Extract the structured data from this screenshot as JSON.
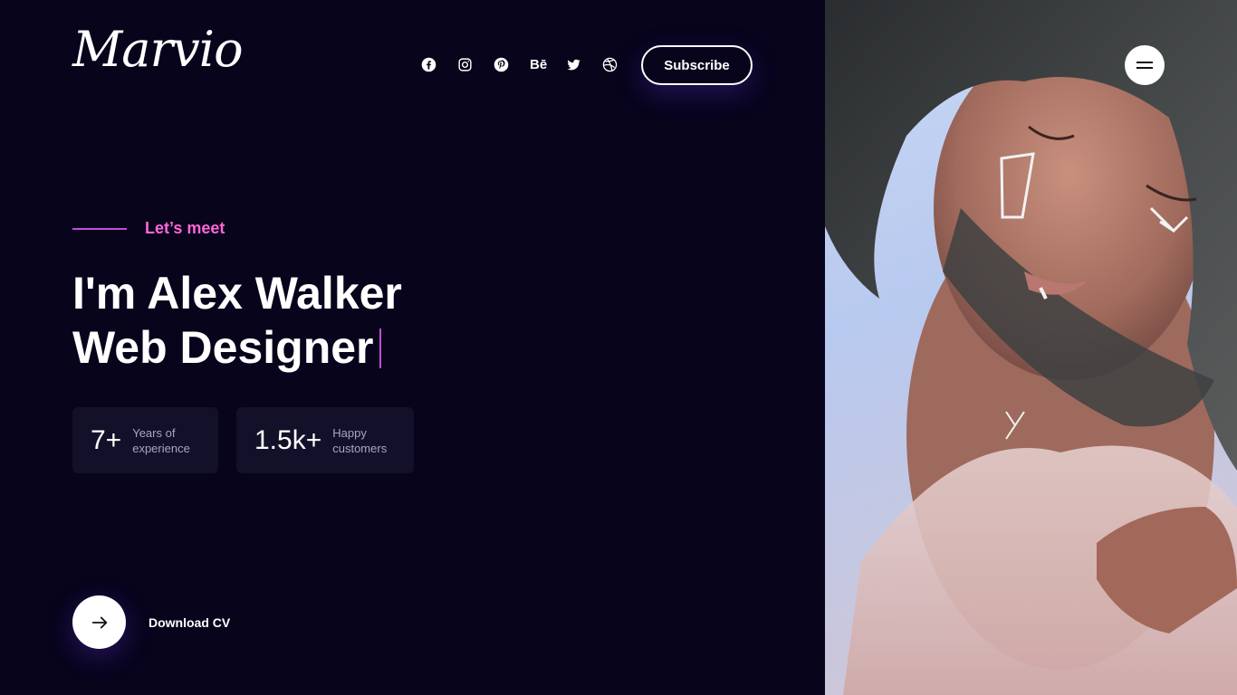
{
  "brand": {
    "logo_text": "Marvio"
  },
  "header": {
    "social": [
      {
        "name": "facebook-icon"
      },
      {
        "name": "instagram-icon"
      },
      {
        "name": "pinterest-icon"
      },
      {
        "name": "behance-icon",
        "text": "Bē"
      },
      {
        "name": "twitter-icon"
      },
      {
        "name": "dribbble-icon"
      }
    ],
    "subscribe_label": "Subscribe"
  },
  "hero": {
    "eyebrow": "Let’s meet",
    "headline_line1": "I'm Alex Walker",
    "headline_line2": "Web Designer",
    "stats": [
      {
        "value": "7+",
        "label_line1": "Years of",
        "label_line2": "experience"
      },
      {
        "value": "1.5k+",
        "label_line1": "Happy",
        "label_line2": "customers"
      }
    ],
    "download_label": "Download CV"
  },
  "colors": {
    "background": "#07041c",
    "accent_pink": "#ff66d8",
    "accent_line": "#c24cd8",
    "stat_card": "#13112a"
  },
  "icons": {
    "download": "arrow-right-icon",
    "menu": "hamburger-icon"
  }
}
